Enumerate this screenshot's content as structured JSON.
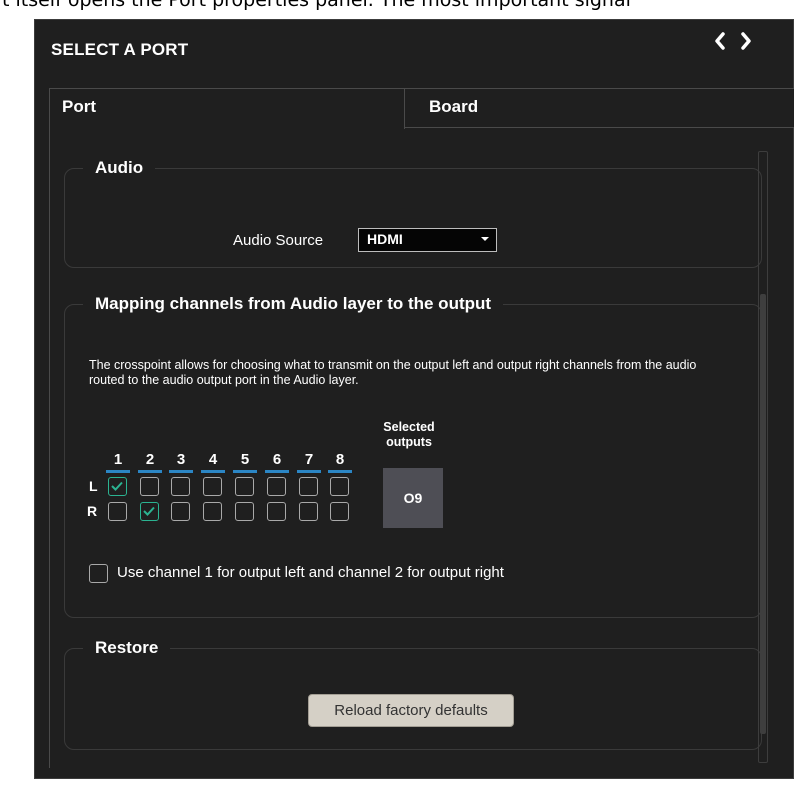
{
  "top_note": "t itself opens the Port properties panel. The most important signal",
  "panel": {
    "title": "SELECT A PORT",
    "nav": {
      "prev_icon": "chevron-left-icon",
      "next_icon": "chevron-right-icon"
    },
    "tabs": [
      {
        "label": "Port",
        "active": true
      },
      {
        "label": "Board",
        "active": false
      }
    ]
  },
  "audio": {
    "legend": "Audio",
    "source_label": "Audio Source",
    "source_value": "HDMI"
  },
  "mapping": {
    "legend": "Mapping channels from Audio layer to the output",
    "description": "The crosspoint allows for choosing what to transmit on the output left and output right channels from the audio routed to the audio output port in the Audio layer.",
    "channels": [
      "1",
      "2",
      "3",
      "4",
      "5",
      "6",
      "7",
      "8"
    ],
    "rows": [
      {
        "label": "L",
        "checked": [
          true,
          false,
          false,
          false,
          false,
          false,
          false,
          false
        ]
      },
      {
        "label": "R",
        "checked": [
          false,
          true,
          false,
          false,
          false,
          false,
          false,
          false
        ]
      }
    ],
    "selected_outputs_label": "Selected outputs",
    "selected_output": "O9",
    "stereo_option_label": "Use channel 1 for output left and channel 2 for output right",
    "stereo_option_checked": false
  },
  "restore": {
    "legend": "Restore",
    "button_label": "Reload factory defaults"
  },
  "colors": {
    "accent_blue": "#2b86c5",
    "check_green": "#2bb391",
    "panel_bg": "#1f1f1f"
  }
}
